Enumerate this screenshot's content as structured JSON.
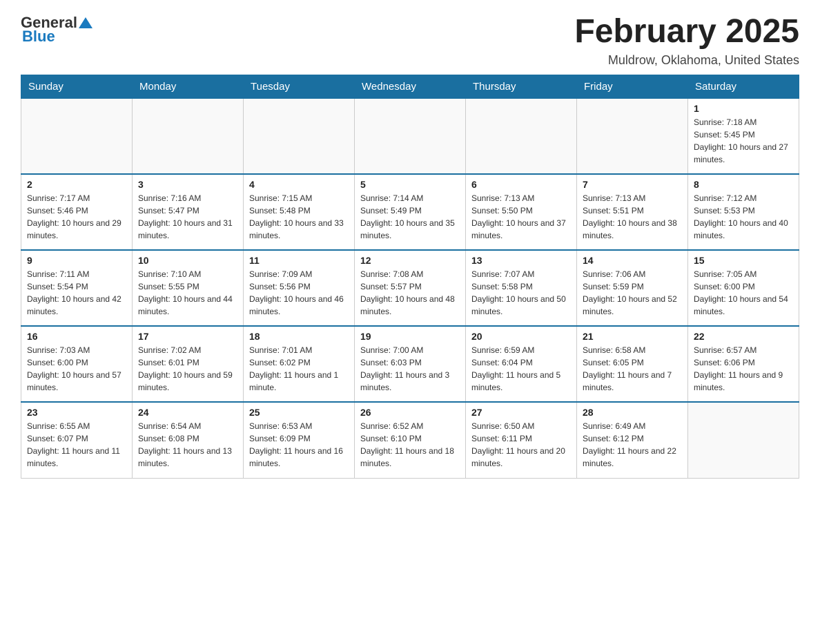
{
  "header": {
    "logo_general": "General",
    "logo_blue": "Blue",
    "month_title": "February 2025",
    "location": "Muldrow, Oklahoma, United States"
  },
  "days_of_week": [
    "Sunday",
    "Monday",
    "Tuesday",
    "Wednesday",
    "Thursday",
    "Friday",
    "Saturday"
  ],
  "weeks": [
    [
      {
        "day": "",
        "info": ""
      },
      {
        "day": "",
        "info": ""
      },
      {
        "day": "",
        "info": ""
      },
      {
        "day": "",
        "info": ""
      },
      {
        "day": "",
        "info": ""
      },
      {
        "day": "",
        "info": ""
      },
      {
        "day": "1",
        "info": "Sunrise: 7:18 AM\nSunset: 5:45 PM\nDaylight: 10 hours and 27 minutes."
      }
    ],
    [
      {
        "day": "2",
        "info": "Sunrise: 7:17 AM\nSunset: 5:46 PM\nDaylight: 10 hours and 29 minutes."
      },
      {
        "day": "3",
        "info": "Sunrise: 7:16 AM\nSunset: 5:47 PM\nDaylight: 10 hours and 31 minutes."
      },
      {
        "day": "4",
        "info": "Sunrise: 7:15 AM\nSunset: 5:48 PM\nDaylight: 10 hours and 33 minutes."
      },
      {
        "day": "5",
        "info": "Sunrise: 7:14 AM\nSunset: 5:49 PM\nDaylight: 10 hours and 35 minutes."
      },
      {
        "day": "6",
        "info": "Sunrise: 7:13 AM\nSunset: 5:50 PM\nDaylight: 10 hours and 37 minutes."
      },
      {
        "day": "7",
        "info": "Sunrise: 7:13 AM\nSunset: 5:51 PM\nDaylight: 10 hours and 38 minutes."
      },
      {
        "day": "8",
        "info": "Sunrise: 7:12 AM\nSunset: 5:53 PM\nDaylight: 10 hours and 40 minutes."
      }
    ],
    [
      {
        "day": "9",
        "info": "Sunrise: 7:11 AM\nSunset: 5:54 PM\nDaylight: 10 hours and 42 minutes."
      },
      {
        "day": "10",
        "info": "Sunrise: 7:10 AM\nSunset: 5:55 PM\nDaylight: 10 hours and 44 minutes."
      },
      {
        "day": "11",
        "info": "Sunrise: 7:09 AM\nSunset: 5:56 PM\nDaylight: 10 hours and 46 minutes."
      },
      {
        "day": "12",
        "info": "Sunrise: 7:08 AM\nSunset: 5:57 PM\nDaylight: 10 hours and 48 minutes."
      },
      {
        "day": "13",
        "info": "Sunrise: 7:07 AM\nSunset: 5:58 PM\nDaylight: 10 hours and 50 minutes."
      },
      {
        "day": "14",
        "info": "Sunrise: 7:06 AM\nSunset: 5:59 PM\nDaylight: 10 hours and 52 minutes."
      },
      {
        "day": "15",
        "info": "Sunrise: 7:05 AM\nSunset: 6:00 PM\nDaylight: 10 hours and 54 minutes."
      }
    ],
    [
      {
        "day": "16",
        "info": "Sunrise: 7:03 AM\nSunset: 6:00 PM\nDaylight: 10 hours and 57 minutes."
      },
      {
        "day": "17",
        "info": "Sunrise: 7:02 AM\nSunset: 6:01 PM\nDaylight: 10 hours and 59 minutes."
      },
      {
        "day": "18",
        "info": "Sunrise: 7:01 AM\nSunset: 6:02 PM\nDaylight: 11 hours and 1 minute."
      },
      {
        "day": "19",
        "info": "Sunrise: 7:00 AM\nSunset: 6:03 PM\nDaylight: 11 hours and 3 minutes."
      },
      {
        "day": "20",
        "info": "Sunrise: 6:59 AM\nSunset: 6:04 PM\nDaylight: 11 hours and 5 minutes."
      },
      {
        "day": "21",
        "info": "Sunrise: 6:58 AM\nSunset: 6:05 PM\nDaylight: 11 hours and 7 minutes."
      },
      {
        "day": "22",
        "info": "Sunrise: 6:57 AM\nSunset: 6:06 PM\nDaylight: 11 hours and 9 minutes."
      }
    ],
    [
      {
        "day": "23",
        "info": "Sunrise: 6:55 AM\nSunset: 6:07 PM\nDaylight: 11 hours and 11 minutes."
      },
      {
        "day": "24",
        "info": "Sunrise: 6:54 AM\nSunset: 6:08 PM\nDaylight: 11 hours and 13 minutes."
      },
      {
        "day": "25",
        "info": "Sunrise: 6:53 AM\nSunset: 6:09 PM\nDaylight: 11 hours and 16 minutes."
      },
      {
        "day": "26",
        "info": "Sunrise: 6:52 AM\nSunset: 6:10 PM\nDaylight: 11 hours and 18 minutes."
      },
      {
        "day": "27",
        "info": "Sunrise: 6:50 AM\nSunset: 6:11 PM\nDaylight: 11 hours and 20 minutes."
      },
      {
        "day": "28",
        "info": "Sunrise: 6:49 AM\nSunset: 6:12 PM\nDaylight: 11 hours and 22 minutes."
      },
      {
        "day": "",
        "info": ""
      }
    ]
  ]
}
